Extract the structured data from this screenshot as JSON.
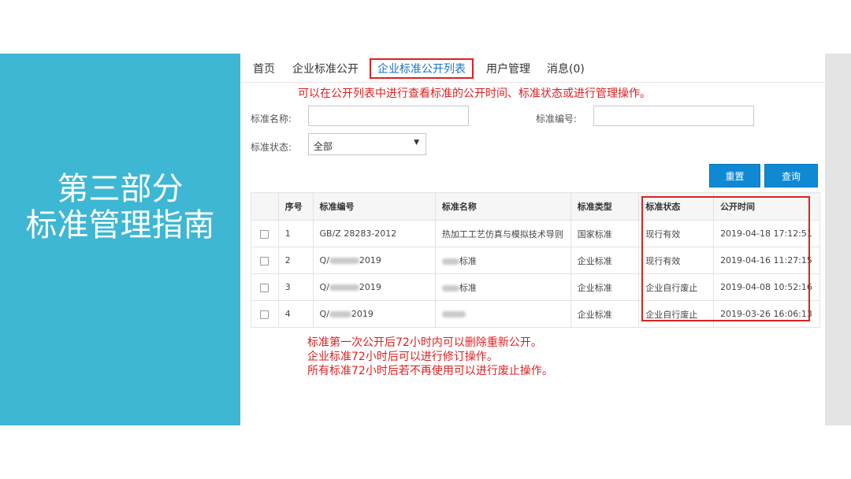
{
  "slide": {
    "title_line1": "第三部分",
    "title_line2": "标准管理指南"
  },
  "nav": {
    "items": [
      "首页",
      "企业标准公开",
      "企业标准公开列表",
      "用户管理",
      "消息(0)"
    ],
    "active_index": 2
  },
  "top_note": "可以在公开列表中进行查看标准的公开时间、标准状态或进行管理操作。",
  "filters": {
    "name_label": "标准名称:",
    "name_value": "",
    "code_label": "标准编号:",
    "code_value": "",
    "status_label": "标准状态:",
    "status_value": "全部"
  },
  "buttons": {
    "reset": "重置",
    "query": "查询"
  },
  "table": {
    "headers": [
      "序号",
      "标准编号",
      "标准名称",
      "标准类型",
      "标准状态",
      "公开时间"
    ],
    "rows": [
      {
        "no": "1",
        "code_prefix": "GB/Z 28283-2012",
        "code_suffix": "",
        "name_prefix": "热加工工艺仿真与模拟技术导则",
        "name_suffix": "",
        "type": "国家标准",
        "status": "现行有效",
        "time": "2019-04-18 17:12:51"
      },
      {
        "no": "2",
        "code_prefix": "Q/",
        "code_suffix": "2019",
        "name_prefix": "",
        "name_suffix": "标准",
        "type": "企业标准",
        "status": "现行有效",
        "time": "2019-04-16 11:27:15"
      },
      {
        "no": "3",
        "code_prefix": "Q/",
        "code_suffix": "2019",
        "name_prefix": "",
        "name_suffix": "标准",
        "type": "企业标准",
        "status": "企业自行废止",
        "time": "2019-04-08 10:52:16"
      },
      {
        "no": "4",
        "code_prefix": "Q/",
        "code_suffix": "2019",
        "name_prefix": "",
        "name_suffix": "",
        "type": "企业标准",
        "status": "企业自行废止",
        "time": "2019-03-26 16:06:13"
      }
    ]
  },
  "bottom_notes": [
    "标准第一次公开后72小时内可以删除重新公开。",
    "企业标准72小时后可以进行修订操作。",
    "所有标准72小时后若不再使用可以进行废止操作。"
  ],
  "colors": {
    "left_panel": "#3db7d3",
    "highlight": "#e02020",
    "button": "#1089d4",
    "active_nav_text": "#1a73c0"
  }
}
